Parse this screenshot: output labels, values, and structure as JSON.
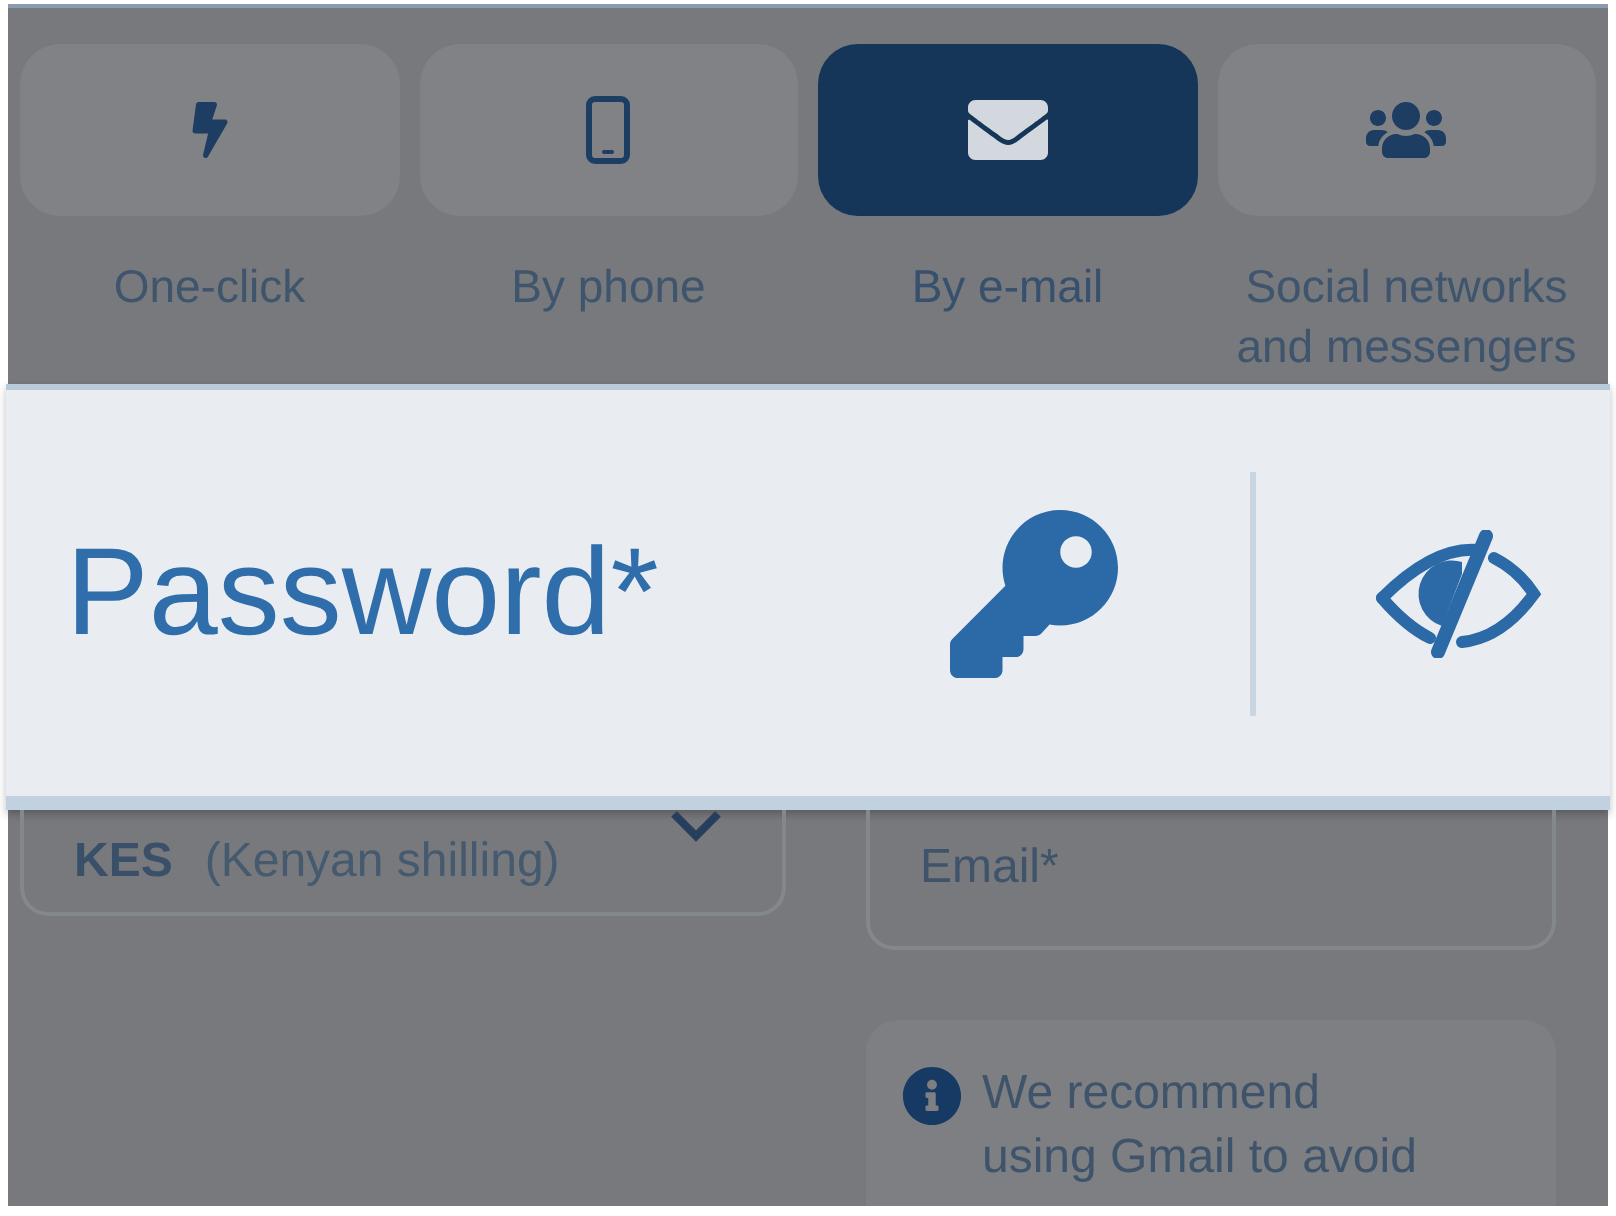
{
  "methods": [
    {
      "label": "One-click",
      "selected": false
    },
    {
      "label": "By phone",
      "selected": false
    },
    {
      "label": "By e-mail",
      "selected": true
    },
    {
      "label": "Social networks and messengers",
      "selected": false
    }
  ],
  "password_field": {
    "placeholder": "Password*"
  },
  "currency_select": {
    "code": "KES",
    "name": "(Kenyan shilling)"
  },
  "email_field": {
    "placeholder": "Email*"
  },
  "notice": {
    "text": "We recommend using Gmail to avoid"
  }
}
